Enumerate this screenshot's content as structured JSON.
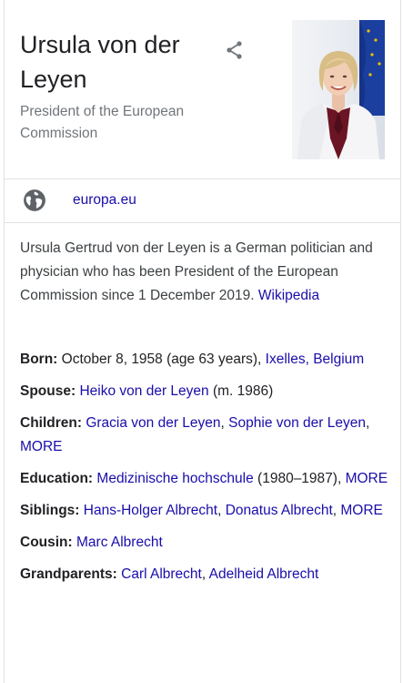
{
  "header": {
    "title": "Ursula von der Leyen",
    "subtitle": "President of the European Commission",
    "share_icon": "share-icon"
  },
  "website": {
    "icon": "globe-icon",
    "label": "europa.eu"
  },
  "description": {
    "text": "Ursula Gertrud von der Leyen is a German politician and physician who has been President of the European Commission since 1 December 2019.",
    "source_label": "Wikipedia"
  },
  "facts": {
    "born": {
      "label": "Born:",
      "text": "October 8, 1958 (age 63 years),",
      "link": "Ixelles, Belgium"
    },
    "spouse": {
      "label": "Spouse:",
      "link": "Heiko von der Leyen",
      "suffix": "(m. 1986)"
    },
    "children": {
      "label": "Children:",
      "link1": "Gracia von der Leyen",
      "link2": "Sophie von der Leyen",
      "more": "MORE"
    },
    "education": {
      "label": "Education:",
      "link": "Medizinische hochschule",
      "suffix": "(1980–1987),",
      "more": "MORE"
    },
    "siblings": {
      "label": "Siblings:",
      "link1": "Hans-Holger Albrecht",
      "link2": "Donatus Albrecht",
      "more": "MORE"
    },
    "cousin": {
      "label": "Cousin:",
      "link": "Marc Albrecht"
    },
    "grandparents": {
      "label": "Grandparents:",
      "link1": "Carl Albrecht",
      "link2": "Adelheid Albrecht"
    }
  },
  "colors": {
    "link": "#1a0dab",
    "muted": "#70757a",
    "text": "#202124",
    "divider": "#dfe1e5"
  }
}
